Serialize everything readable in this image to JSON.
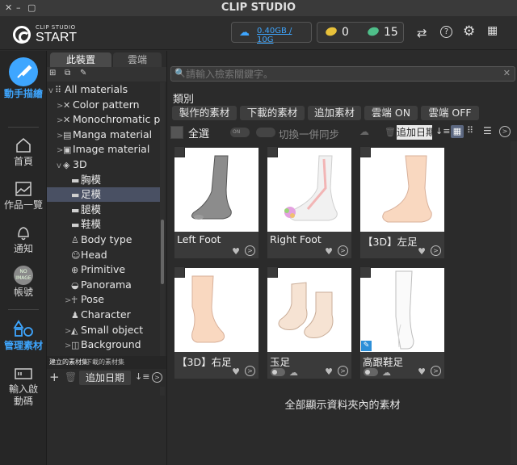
{
  "app": {
    "title": "CLIP STUDIO",
    "window_buttons": [
      "✕",
      "–",
      "▢"
    ]
  },
  "header": {
    "logo_small": "CLIP STUDIO",
    "logo_big": "START",
    "cloud_storage": "0.40GB / 10G",
    "gold_count": "0",
    "clippy_count": "15",
    "icons": [
      "sync-icon",
      "help-icon",
      "gear-icon",
      "grid-icon"
    ]
  },
  "nav": [
    {
      "label": "動手描繪",
      "icon": "paint-brush-icon",
      "active": true
    },
    {
      "label": "首頁",
      "icon": "home-icon"
    },
    {
      "label": "作品一覽",
      "icon": "gallery-icon"
    },
    {
      "label": "通知",
      "icon": "bell-icon"
    },
    {
      "label": "帳號",
      "icon": "account-icon",
      "badge": "NO\nIMAGE"
    },
    {
      "label": "管理素材",
      "icon": "materials-icon",
      "active_section": true
    },
    {
      "label": "輸入啟動碼",
      "icon": "serial-icon"
    }
  ],
  "tree_panel": {
    "tabs": [
      "此裝置",
      "雲端"
    ],
    "nodes": [
      {
        "label": "All materials",
        "indent": 0,
        "arrow": "v",
        "icon": "⠿"
      },
      {
        "label": "Color pattern",
        "indent": 1,
        "arrow": ">",
        "icon": "✕"
      },
      {
        "label": "Monochromatic p",
        "indent": 1,
        "arrow": ">",
        "icon": "✕"
      },
      {
        "label": "Manga material",
        "indent": 1,
        "arrow": ">",
        "icon": "▤"
      },
      {
        "label": "Image material",
        "indent": 1,
        "arrow": ">",
        "icon": "▣"
      },
      {
        "label": "3D",
        "indent": 1,
        "arrow": "v",
        "icon": "◈"
      },
      {
        "label": "胸模",
        "indent": 2,
        "arrow": "",
        "icon": "▬"
      },
      {
        "label": "足模",
        "indent": 2,
        "arrow": "",
        "icon": "▬",
        "selected": true
      },
      {
        "label": "腿模",
        "indent": 2,
        "arrow": "",
        "icon": "▬"
      },
      {
        "label": "鞋模",
        "indent": 2,
        "arrow": "",
        "icon": "▬"
      },
      {
        "label": "Body type",
        "indent": 2,
        "arrow": "",
        "icon": "♙"
      },
      {
        "label": "Head",
        "indent": 2,
        "arrow": "",
        "icon": "☺"
      },
      {
        "label": "Primitive",
        "indent": 2,
        "arrow": "",
        "icon": "⊕"
      },
      {
        "label": "Panorama",
        "indent": 2,
        "arrow": "",
        "icon": "◒"
      },
      {
        "label": "Pose",
        "indent": 2,
        "arrow": ">",
        "icon": "☥"
      },
      {
        "label": "Character",
        "indent": 2,
        "arrow": "",
        "icon": "♟"
      },
      {
        "label": "Small object",
        "indent": 2,
        "arrow": ">",
        "icon": "◭"
      },
      {
        "label": "Background",
        "indent": 2,
        "arrow": ">",
        "icon": "◫"
      }
    ],
    "bottom_tabs": [
      "建立的素材集",
      "下載的素材集"
    ],
    "sort_label": "追加日期"
  },
  "main": {
    "search_placeholder": "請輸入檢索關鍵字。",
    "category_label": "類別",
    "chips": [
      "製作的素材",
      "下載的素材",
      "追加素材",
      "雲端 ON",
      "雲端 OFF"
    ],
    "select_all": "全選",
    "sync_label": "切換一併同步",
    "toggle_on": "ON",
    "sort_label": "追加日期",
    "cards": [
      {
        "name": "Left Foot",
        "kind": "grey-foot"
      },
      {
        "name": "Right Foot",
        "kind": "xray-foot"
      },
      {
        "name": "【3D】左足",
        "kind": "skin-foot-left"
      },
      {
        "name": "【3D】右足",
        "kind": "skin-foot-right"
      },
      {
        "name": "玉足",
        "kind": "two-feet",
        "cloud": true
      },
      {
        "name": "高跟鞋足",
        "kind": "white-foot",
        "cloud": true,
        "badge": true
      }
    ],
    "footer_message": "全部顯示資料夾內的素材"
  },
  "colors": {
    "accent": "#3ea6ff",
    "bg": "#2b2b2b",
    "selected": "#495063"
  }
}
